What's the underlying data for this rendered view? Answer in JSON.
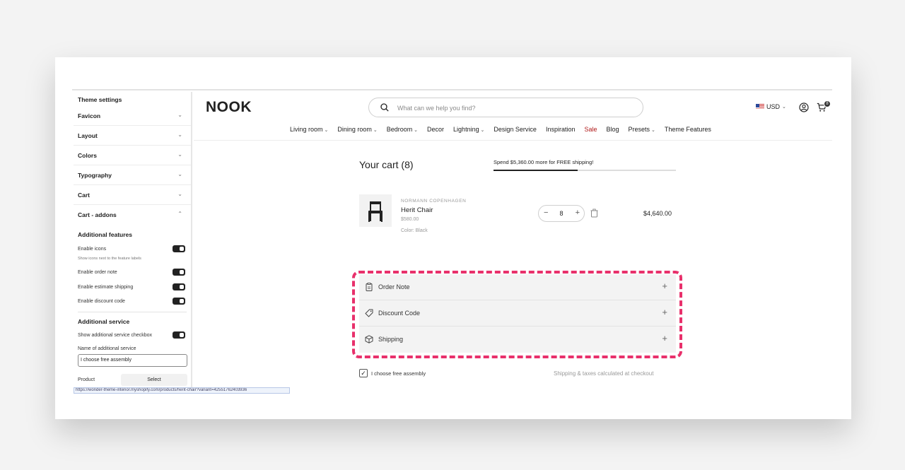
{
  "sidebar": {
    "title": "Theme settings",
    "sections": [
      {
        "label": "Favicon",
        "chevron": "⌄"
      },
      {
        "label": "Layout",
        "chevron": "⌄"
      },
      {
        "label": "Colors",
        "chevron": "⌄"
      },
      {
        "label": "Typography",
        "chevron": "⌄"
      },
      {
        "label": "Cart",
        "chevron": "⌄"
      },
      {
        "label": "Cart - addons",
        "chevron": "⌃"
      }
    ],
    "additional_features_heading": "Additional features",
    "enable_icons": "Enable icons",
    "enable_icons_hint": "Show icons next to the feature labels",
    "enable_order_note": "Enable order note",
    "enable_estimate_shipping": "Enable estimate shipping",
    "enable_discount_code": "Enable discount code",
    "additional_service_heading": "Additional service",
    "show_additional_service": "Show additional service checkbox",
    "name_of_service_label": "Name of additional service",
    "name_of_service_value": "I choose free assembly",
    "product_label": "Product",
    "select_button": "Select",
    "url_text": "https://wonder-theme-interior.myshopify.com/products/herit-chair?variant=42551762403936"
  },
  "header": {
    "logo": "NOOK",
    "search_placeholder": "What can we help you find?",
    "currency": "USD",
    "currency_chevron": "⌄",
    "cart_count": "8",
    "nav": [
      {
        "label": "Living room",
        "dropdown": true
      },
      {
        "label": "Dining room",
        "dropdown": true
      },
      {
        "label": "Bedroom",
        "dropdown": true
      },
      {
        "label": "Decor",
        "dropdown": false
      },
      {
        "label": "Lightning",
        "dropdown": true
      },
      {
        "label": "Design Service",
        "dropdown": false
      },
      {
        "label": "Inspiration",
        "dropdown": false
      },
      {
        "label": "Sale",
        "dropdown": false
      },
      {
        "label": "Blog",
        "dropdown": false
      },
      {
        "label": "Presets",
        "dropdown": true
      },
      {
        "label": "Theme Features",
        "dropdown": false
      }
    ]
  },
  "cart": {
    "title": "Your cart (8)",
    "shipping_message": "Spend $5,360.00 more for FREE shipping!",
    "shipping_progress": 0.46,
    "item": {
      "vendor": "NORMANN COPENHAGEN",
      "name": "Herit Chair",
      "price": "$580.00",
      "color": "Color: Black",
      "quantity": "8",
      "minus": "−",
      "plus": "+",
      "line_total": "$4,640.00"
    },
    "addons": [
      {
        "label": "Order Note",
        "icon": "clipboard-icon",
        "plus": "+"
      },
      {
        "label": "Discount Code",
        "icon": "tag-icon",
        "plus": "+"
      },
      {
        "label": "Shipping",
        "icon": "box-icon",
        "plus": "+"
      }
    ],
    "assembly_check": "✓",
    "assembly_label": "I choose free assembly",
    "shipping_note": "Shipping & taxes calculated at checkout"
  },
  "colors": {
    "highlight": "#e8306b",
    "sale": "#b01919"
  }
}
